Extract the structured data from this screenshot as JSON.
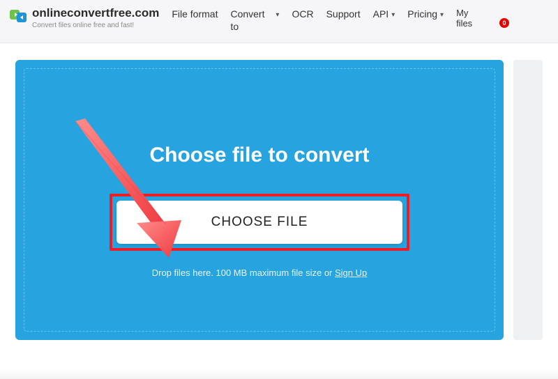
{
  "brand": {
    "name": "onlineconvertfree.com",
    "tagline": "Convert files online free and fast!"
  },
  "nav": {
    "file_format": "File format",
    "convert_to": "Convert to",
    "ocr": "OCR",
    "support": "Support",
    "api": "API",
    "pricing": "Pricing",
    "my_files": "My files",
    "badge_count": "0"
  },
  "panel": {
    "heading": "Choose file to convert",
    "choose_label": "CHOOSE FILE",
    "hint_prefix": "Drop files here. 100 MB maximum file size or ",
    "hint_link": "Sign Up"
  }
}
